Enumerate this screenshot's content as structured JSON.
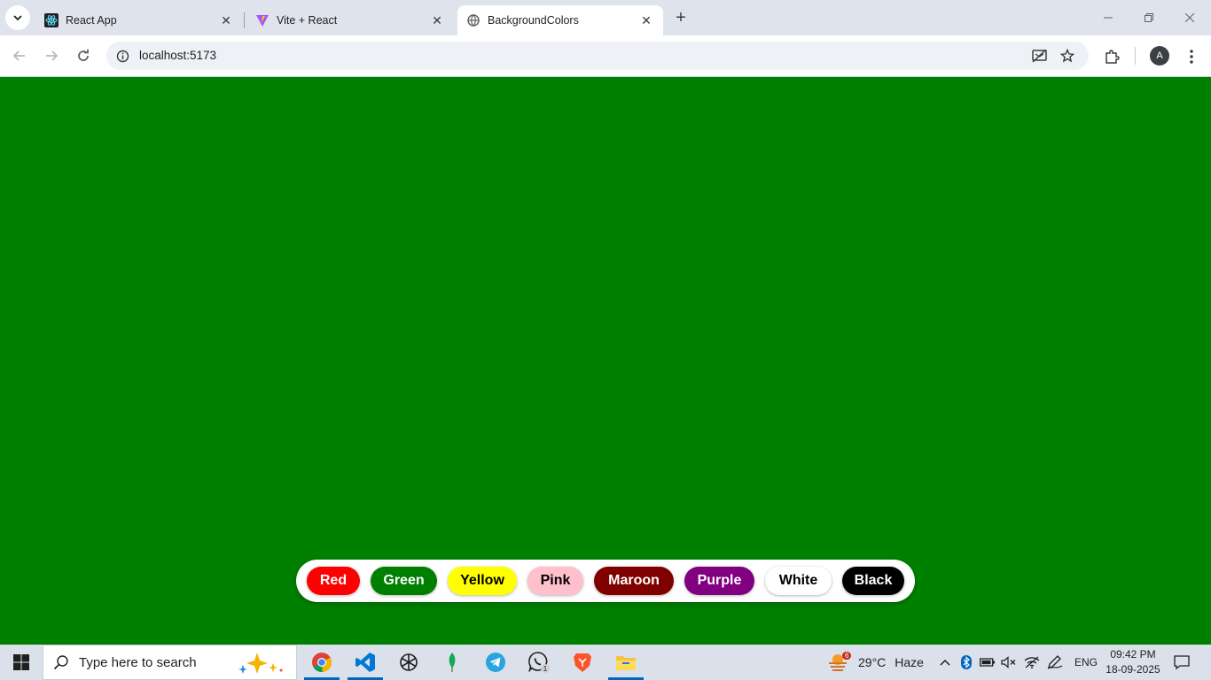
{
  "browser": {
    "tabs": [
      {
        "title": "React App",
        "icon": "react-icon"
      },
      {
        "title": "Vite + React",
        "icon": "vite-icon"
      },
      {
        "title": "BackgroundColors",
        "icon": "globe-icon",
        "active": true
      }
    ],
    "new_tab_label": "+",
    "address": "localhost:5173",
    "profile_initial": "A"
  },
  "page": {
    "background_color": "#008000",
    "buttons": [
      {
        "label": "Red",
        "bg": "#ff0000",
        "fg": "#ffffff"
      },
      {
        "label": "Green",
        "bg": "#008000",
        "fg": "#ffffff"
      },
      {
        "label": "Yellow",
        "bg": "#ffff00",
        "fg": "#000000"
      },
      {
        "label": "Pink",
        "bg": "#ffc0cb",
        "fg": "#000000"
      },
      {
        "label": "Maroon",
        "bg": "#800000",
        "fg": "#ffffff"
      },
      {
        "label": "Purple",
        "bg": "#800080",
        "fg": "#ffffff"
      },
      {
        "label": "White",
        "bg": "#ffffff",
        "fg": "#000000"
      },
      {
        "label": "Black",
        "bg": "#000000",
        "fg": "#ffffff"
      }
    ]
  },
  "taskbar": {
    "search_placeholder": "Type here to search",
    "apps": [
      "chrome-icon",
      "vscode-icon",
      "chatgpt-icon",
      "mongodb-icon",
      "telegram-icon",
      "whatsapp-icon",
      "brave-icon",
      "file-explorer-icon"
    ],
    "whatsapp_badge": "1",
    "weather": {
      "badge": "6",
      "temp": "29°C",
      "condition": "Haze"
    },
    "language": "ENG",
    "time": "09:42 PM",
    "date": "18-09-2025"
  }
}
